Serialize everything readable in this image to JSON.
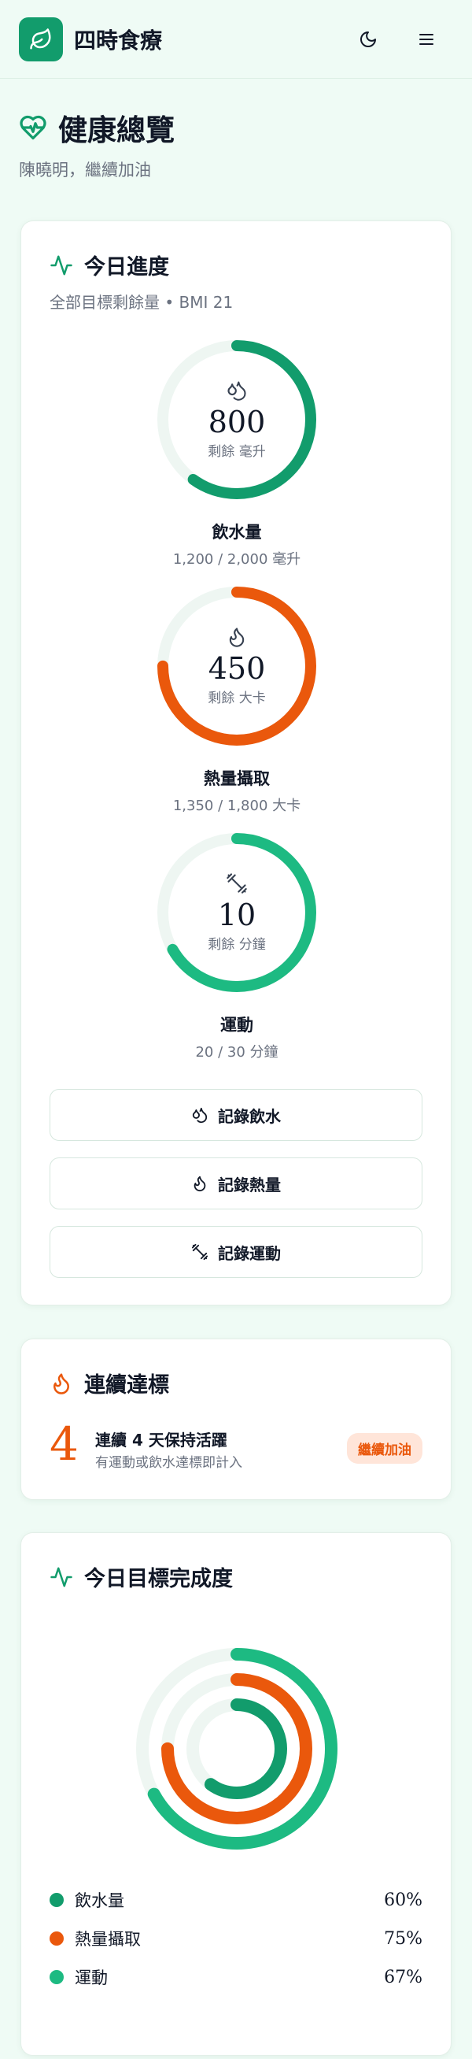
{
  "app": {
    "title": "四時食療"
  },
  "header": {
    "theme_icon": "moon-icon",
    "menu_icon": "menu-icon",
    "logo_icon": "leaf-icon"
  },
  "page": {
    "title": "健康總覽",
    "title_icon": "heart-pulse-icon",
    "subtitle": "陳曉明，繼續加油"
  },
  "today": {
    "title": "今日進度",
    "title_icon": "activity-icon",
    "subtitle": "全部目標剩餘量 • BMI 21",
    "rings": [
      {
        "id": "water",
        "icon": "droplets-icon",
        "value": "800",
        "unit": "剩餘 毫升",
        "label": "飲水量",
        "detail": "1,200 / 2,000 毫升",
        "progress": 0.6,
        "color": "#129c6c"
      },
      {
        "id": "calories",
        "icon": "flame-icon",
        "value": "450",
        "unit": "剩餘 大卡",
        "label": "熱量攝取",
        "detail": "1,350 / 1,800 大卡",
        "progress": 0.75,
        "color": "#ea580c"
      },
      {
        "id": "exercise",
        "icon": "dumbbell-icon",
        "value": "10",
        "unit": "剩餘 分鐘",
        "label": "運動",
        "detail": "20 / 30 分鐘",
        "progress": 0.6667,
        "color": "#1dba82"
      }
    ],
    "buttons": [
      {
        "id": "log-water",
        "icon": "droplets-icon",
        "label": "記錄飲水"
      },
      {
        "id": "log-calories",
        "icon": "flame-icon",
        "label": "記錄熱量"
      },
      {
        "id": "log-exercise",
        "icon": "dumbbell-icon",
        "label": "記錄運動"
      }
    ]
  },
  "streak": {
    "title": "連續達標",
    "title_icon": "flame-icon",
    "count": "4",
    "headline": "連續 4 天保持活躍",
    "description": "有運動或飲水達標即計入",
    "badge": "繼續加油"
  },
  "completion": {
    "title": "今日目標完成度",
    "title_icon": "activity-icon",
    "items": [
      {
        "label": "飲水量",
        "percent": "60%",
        "progress": 0.6,
        "color": "#129c6c"
      },
      {
        "label": "熱量攝取",
        "percent": "75%",
        "progress": 0.75,
        "color": "#ea580c"
      },
      {
        "label": "運動",
        "percent": "67%",
        "progress": 0.67,
        "color": "#1dba82"
      }
    ]
  },
  "colors": {
    "accent": "#129c6c",
    "orange": "#ea580c",
    "light_green": "#1dba82",
    "track": "#eef6f2"
  }
}
